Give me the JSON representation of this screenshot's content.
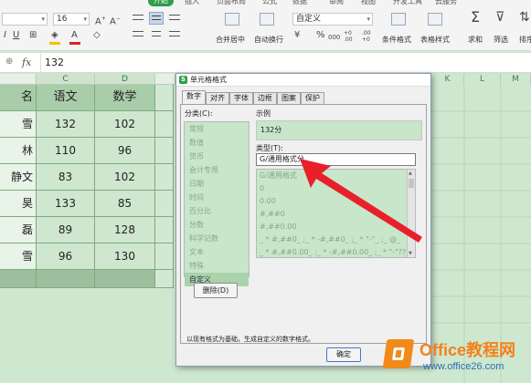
{
  "ribbon": {
    "tabs": [
      "开始",
      "插入",
      "页面布局",
      "公式",
      "数据",
      "审阅",
      "视图",
      "开发工具",
      "云服务"
    ],
    "font_size": "16",
    "number_format": "自定义",
    "labels": {
      "merge_center": "合并居中",
      "auto_wrap": "自动换行",
      "conditional_format": "条件格式",
      "table_style": "表格样式",
      "sum": "求和",
      "filter": "筛选",
      "sort": "排序"
    },
    "number_symbols": [
      "¥",
      "%",
      "000",
      "+0 .00",
      ".00 +0"
    ]
  },
  "formula_bar": {
    "fx": "fx",
    "value": "132"
  },
  "sheet": {
    "col_headers": [
      "C",
      "D",
      "K",
      "L",
      "M"
    ],
    "rows": [
      [
        "名",
        "语文",
        "数学"
      ],
      [
        "雪",
        "132",
        "102"
      ],
      [
        "林",
        "110",
        "96"
      ],
      [
        "静文",
        "83",
        "102"
      ],
      [
        "昊",
        "133",
        "85"
      ],
      [
        "磊",
        "89",
        "128"
      ],
      [
        "雪",
        "96",
        "130"
      ]
    ]
  },
  "dialog": {
    "title": "单元格格式",
    "tabs": [
      "数字",
      "对齐",
      "字体",
      "边框",
      "图案",
      "保护"
    ],
    "category_label": "分类(C):",
    "categories": [
      "常规",
      "数值",
      "货币",
      "会计专用",
      "日期",
      "时间",
      "百分比",
      "分数",
      "科学记数",
      "文本",
      "特殊",
      "自定义"
    ],
    "delete_button": "删除(D)",
    "sample_label": "示例",
    "sample_value": "132分",
    "type_label": "类型(T):",
    "type_value": "G/通用格式分",
    "formats": [
      "G/通用格式",
      "0",
      "0.00",
      "#,##0",
      "#,##0.00",
      "_ * #,##0_ ;_ * -#,##0_ ;_ * \"-\"_ ;_ @_",
      "_ * #,##0.00_ ;_ * -#,##0.00_ ;_ * \"-\"??_ ;_ @_"
    ],
    "hint": "以现有格式为基础，生成自定义的数字格式。",
    "ok_button": "确定"
  },
  "watermark": {
    "brand": "Office教程网",
    "url": "www.office26.com"
  },
  "colors": {
    "accent_green": "#2e9e48",
    "sheet_green": "#cde8cf",
    "arrow_red": "#e8202a",
    "watermark_orange": "#f28a1a"
  }
}
